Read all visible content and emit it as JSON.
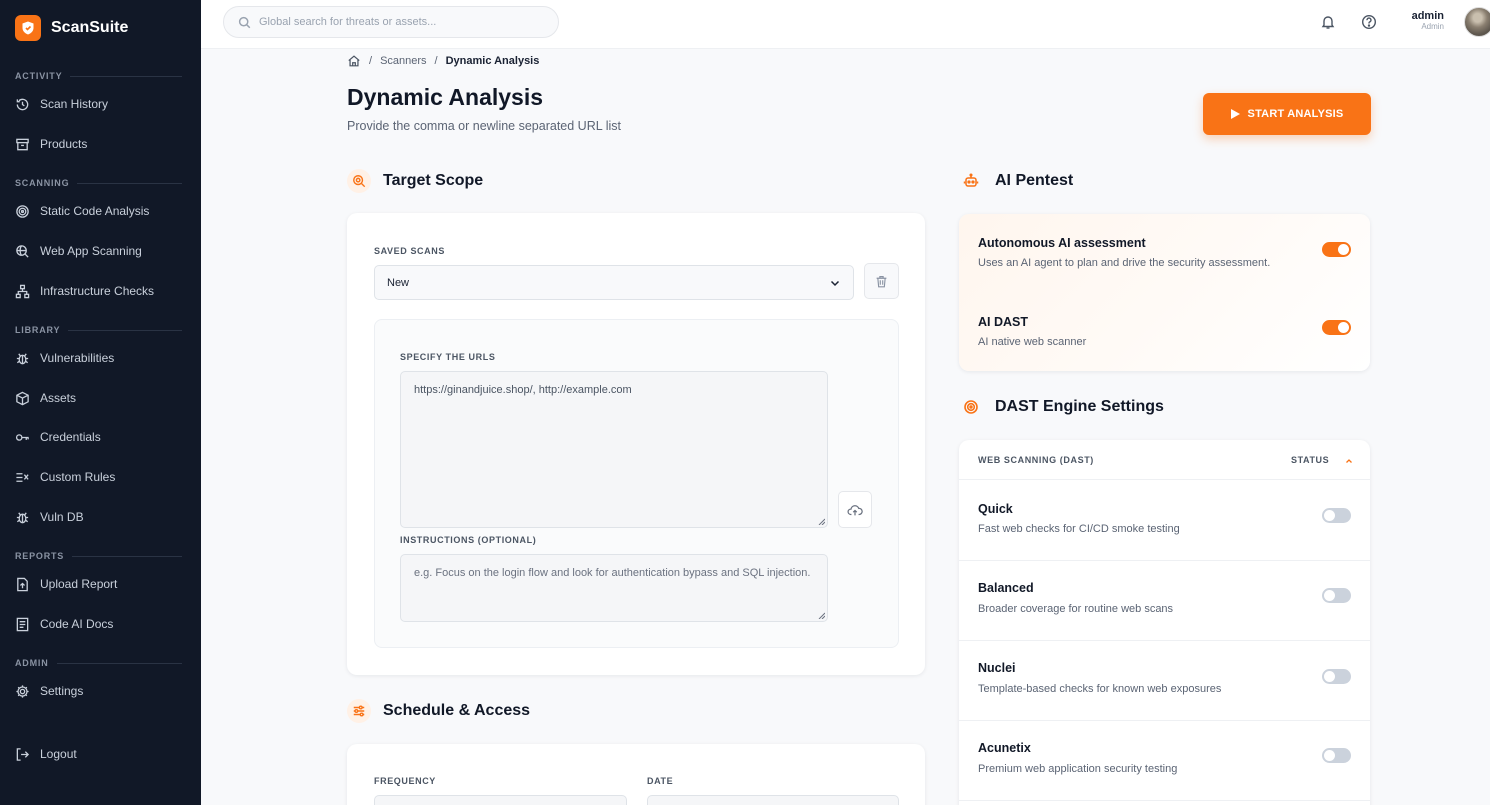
{
  "brand": {
    "name": "ScanSuite",
    "accent": "#f97316"
  },
  "sidebar": {
    "sections": [
      {
        "label": "ACTIVITY"
      },
      {
        "label": "SCANNING"
      },
      {
        "label": "LIBRARY"
      },
      {
        "label": "REPORTS"
      },
      {
        "label": "ADMIN"
      }
    ],
    "items": [
      {
        "label": "Scan History",
        "icon": "history-icon"
      },
      {
        "label": "Products",
        "icon": "archive-icon"
      },
      {
        "label": "Static Code Analysis",
        "icon": "target-icon"
      },
      {
        "label": "Web App Scanning",
        "icon": "web-scan-icon"
      },
      {
        "label": "Infrastructure Checks",
        "icon": "network-icon"
      },
      {
        "label": "Vulnerabilities",
        "icon": "bug-icon"
      },
      {
        "label": "Assets",
        "icon": "cube-icon"
      },
      {
        "label": "Credentials",
        "icon": "key-icon"
      },
      {
        "label": "Custom Rules",
        "icon": "rules-icon"
      },
      {
        "label": "Vuln DB",
        "icon": "bug-icon"
      },
      {
        "label": "Upload Report",
        "icon": "upload-file-icon"
      },
      {
        "label": "Code AI Docs",
        "icon": "document-icon"
      },
      {
        "label": "Settings",
        "icon": "gear-icon"
      },
      {
        "label": "Logout",
        "icon": "logout-icon"
      }
    ]
  },
  "topbar": {
    "search_placeholder": "Global search for threats or assets...",
    "user_name": "admin",
    "user_role": "Admin"
  },
  "breadcrumb": {
    "level1": "Scanners",
    "current": "Dynamic Analysis"
  },
  "page": {
    "title": "Dynamic Analysis",
    "subtitle": "Provide the comma or newline separated URL list",
    "start_button": "START ANALYSIS"
  },
  "target_scope": {
    "title": "Target Scope",
    "saved_scans_label": "SAVED SCANS",
    "saved_scans_value": "New",
    "urls_label": "SPECIFY THE URLS",
    "urls_value": "https://ginandjuice.shop/, http://example.com",
    "instructions_label": "INSTRUCTIONS (OPTIONAL)",
    "instructions_placeholder": "e.g. Focus on the login flow and look for authentication bypass and SQL injection."
  },
  "schedule": {
    "title": "Schedule & Access",
    "frequency_label": "FREQUENCY",
    "date_label": "DATE"
  },
  "ai_pentest": {
    "title": "AI Pentest",
    "options": [
      {
        "title": "Autonomous AI assessment",
        "desc": "Uses an AI agent to plan and drive the security assessment.",
        "enabled": true
      },
      {
        "title": "AI DAST",
        "desc": "AI native web scanner",
        "enabled": true
      }
    ]
  },
  "dast": {
    "title": "DAST Engine Settings",
    "header_left": "WEB SCANNING (DAST)",
    "header_right": "STATUS",
    "engines": [
      {
        "title": "Quick",
        "desc": "Fast web checks for CI/CD smoke testing",
        "enabled": false
      },
      {
        "title": "Balanced",
        "desc": "Broader coverage for routine web scans",
        "enabled": false
      },
      {
        "title": "Nuclei",
        "desc": "Template-based checks for known web exposures",
        "enabled": false
      },
      {
        "title": "Acunetix",
        "desc": "Premium web application security testing",
        "enabled": false
      }
    ]
  }
}
